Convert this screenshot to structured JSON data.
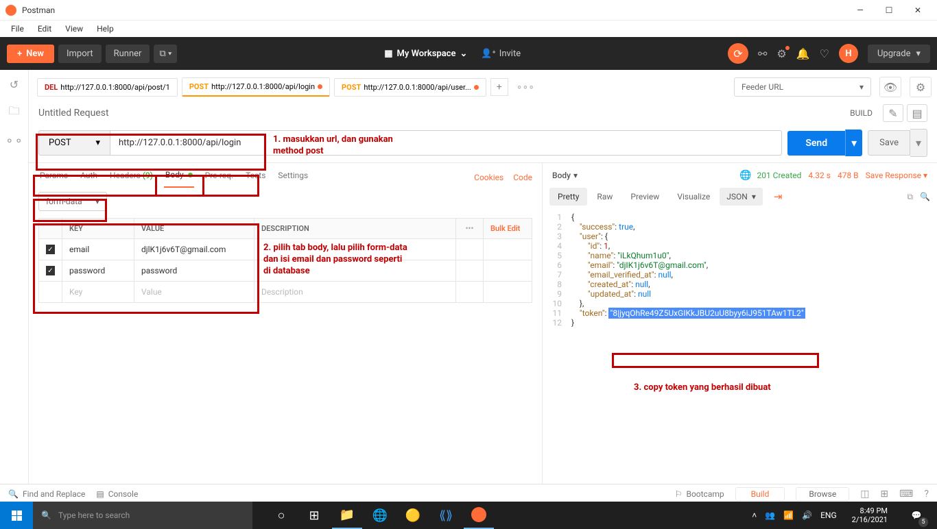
{
  "titlebar": {
    "app": "Postman"
  },
  "menubar": [
    "File",
    "Edit",
    "View",
    "Help"
  ],
  "toolbar": {
    "new": "New",
    "import": "Import",
    "runner": "Runner",
    "workspace": "My Workspace",
    "invite": "Invite",
    "avatar": "H",
    "upgrade": "Upgrade"
  },
  "env": {
    "selected": "Feeder URL"
  },
  "tabs": [
    {
      "method": "DEL",
      "cls": "method-del",
      "url": "http://127.0.0.1:8000/api/post/1"
    },
    {
      "method": "POST",
      "cls": "method-post",
      "url": "http://127.0.0.1:8000/api/login",
      "active": true
    },
    {
      "method": "POST",
      "cls": "method-post",
      "url": "http://127.0.0.1:8000/api/user..."
    }
  ],
  "request": {
    "title": "Untitled Request",
    "build": "BUILD",
    "method": "POST",
    "url": "http://127.0.0.1:8000/api/login",
    "send": "Send",
    "save": "Save",
    "subtabs": {
      "params": "Params",
      "auth": "Auth",
      "headers": "Headers",
      "headers_count": "(9)",
      "body": "Body",
      "prereq": "Pre-req.",
      "tests": "Tests",
      "settings": "Settings",
      "cookies": "Cookies",
      "code": "Code"
    },
    "body_type": "form-data",
    "kv_headers": {
      "key": "KEY",
      "value": "VALUE",
      "desc": "DESCRIPTION",
      "bulk": "Bulk Edit"
    },
    "kv": [
      {
        "k": "email",
        "v": "djlK1j6v6T@gmail.com"
      },
      {
        "k": "password",
        "v": "password"
      }
    ],
    "kv_placeholders": {
      "key": "Key",
      "value": "Value",
      "desc": "Description"
    }
  },
  "annotations": {
    "a1": "1. masukkan url, dan gunakan method post",
    "a2": "2. pilih tab body, lalu pilih form-data dan isi email dan password seperti di database",
    "a3": "3. copy token yang berhasil dibuat"
  },
  "response": {
    "body": "Body",
    "status": "201 Created",
    "time": "4.32 s",
    "size": "478 B",
    "save": "Save Response",
    "tabs": {
      "pretty": "Pretty",
      "raw": "Raw",
      "preview": "Preview",
      "visualize": "Visualize",
      "json": "JSON"
    },
    "lines": [
      {
        "n": 1,
        "pad": 0,
        "tokens": [
          [
            "punc",
            "{"
          ]
        ]
      },
      {
        "n": 2,
        "pad": 1,
        "tokens": [
          [
            "key",
            "\"success\""
          ],
          [
            "punc",
            ": "
          ],
          [
            "bool",
            "true"
          ],
          [
            "punc",
            ","
          ]
        ]
      },
      {
        "n": 3,
        "pad": 1,
        "tokens": [
          [
            "key",
            "\"user\""
          ],
          [
            "punc",
            ": {"
          ]
        ]
      },
      {
        "n": 4,
        "pad": 2,
        "tokens": [
          [
            "key",
            "\"id\""
          ],
          [
            "punc",
            ": "
          ],
          [
            "num",
            "1"
          ],
          [
            "punc",
            ","
          ]
        ]
      },
      {
        "n": 5,
        "pad": 2,
        "tokens": [
          [
            "key",
            "\"name\""
          ],
          [
            "punc",
            ": "
          ],
          [
            "str",
            "\"iLkQhum1u0\""
          ],
          [
            "punc",
            ","
          ]
        ]
      },
      {
        "n": 6,
        "pad": 2,
        "tokens": [
          [
            "key",
            "\"email\""
          ],
          [
            "punc",
            ": "
          ],
          [
            "str",
            "\"djIK1j6v6T@gmail.com\""
          ],
          [
            "punc",
            ","
          ]
        ]
      },
      {
        "n": 7,
        "pad": 2,
        "tokens": [
          [
            "key",
            "\"email_verified_at\""
          ],
          [
            "punc",
            ": "
          ],
          [
            "null",
            "null"
          ],
          [
            "punc",
            ","
          ]
        ]
      },
      {
        "n": 8,
        "pad": 2,
        "tokens": [
          [
            "key",
            "\"created_at\""
          ],
          [
            "punc",
            ": "
          ],
          [
            "null",
            "null"
          ],
          [
            "punc",
            ","
          ]
        ]
      },
      {
        "n": 9,
        "pad": 2,
        "tokens": [
          [
            "key",
            "\"updated_at\""
          ],
          [
            "punc",
            ": "
          ],
          [
            "null",
            "null"
          ]
        ]
      },
      {
        "n": 10,
        "pad": 1,
        "tokens": [
          [
            "punc",
            "},"
          ]
        ]
      },
      {
        "n": 11,
        "pad": 1,
        "tokens": [
          [
            "key",
            "\"token\""
          ],
          [
            "punc",
            ": "
          ],
          [
            "hi",
            "\"8|jyqOhRe49Z5UxGIKkJBU2uU8byy6iJ951TAw1TL2\""
          ]
        ]
      },
      {
        "n": 12,
        "pad": 0,
        "tokens": [
          [
            "punc",
            "}"
          ]
        ]
      }
    ]
  },
  "footer": {
    "find": "Find and Replace",
    "console": "Console",
    "bootcamp": "Bootcamp",
    "build": "Build",
    "browse": "Browse"
  },
  "taskbar": {
    "search_placeholder": "Type here to search",
    "lang": "ENG",
    "time": "8:49 PM",
    "date": "2/16/2021",
    "notif_count": "5"
  }
}
